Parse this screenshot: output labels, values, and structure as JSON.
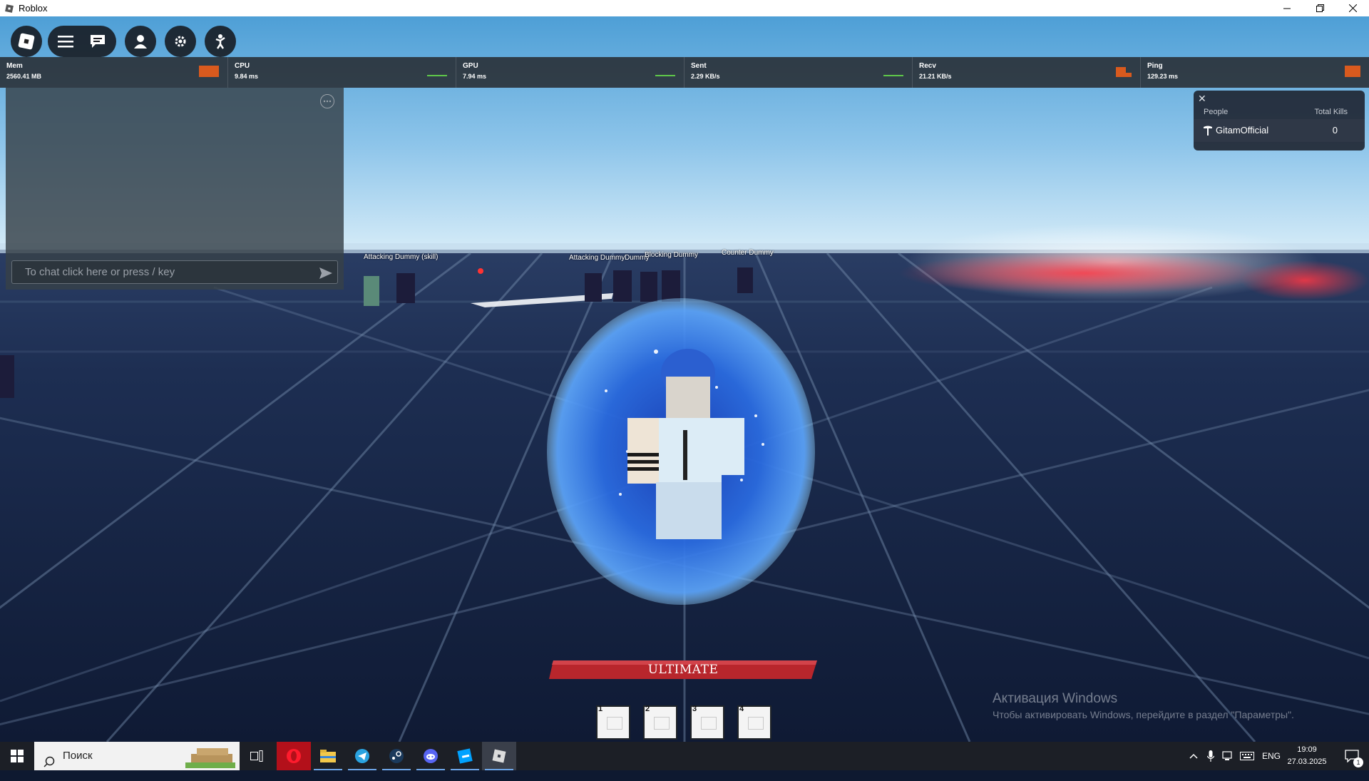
{
  "window": {
    "title": "Roblox"
  },
  "stats": [
    {
      "label": "Mem",
      "value": "2560.41 MB"
    },
    {
      "label": "CPU",
      "value": "9.84 ms"
    },
    {
      "label": "GPU",
      "value": "7.94 ms"
    },
    {
      "label": "Sent",
      "value": "2.29 KB/s"
    },
    {
      "label": "Recv",
      "value": "21.21 KB/s"
    },
    {
      "label": "Ping",
      "value": "129.23 ms"
    }
  ],
  "chat": {
    "placeholder": "To chat click here or press / key"
  },
  "leaderboard": {
    "col_people": "People",
    "col_kills": "Total Kills",
    "rows": [
      {
        "player": "GitamOfficial",
        "kills": "0"
      }
    ]
  },
  "dummies": [
    {
      "label": "Attacking Dummy (skill)"
    },
    {
      "label": "Attacking Dummy"
    },
    {
      "label": "Dummy"
    },
    {
      "label": "Blocking Dummy"
    },
    {
      "label": "Counter Dummy"
    }
  ],
  "hud": {
    "ultimate_label": "ULTIMATE",
    "slots": [
      {
        "number": "1"
      },
      {
        "number": "2"
      },
      {
        "number": "3"
      },
      {
        "number": "4"
      }
    ]
  },
  "activation": {
    "title": "Активация Windows",
    "subtitle": "Чтобы активировать Windows, перейдите в раздел \"Параметры\"."
  },
  "taskbar": {
    "search_label": "Поиск",
    "language": "ENG",
    "time": "19:09",
    "date": "27.03.2025",
    "notification_count": "1"
  },
  "colors": {
    "sky_top": "#4e9fd6",
    "floor": "#142240",
    "ultimate_bar": "#b8262c",
    "aura": "#2a6be0",
    "stat_bar": "#d95a1e",
    "stat_graph": "#5fc84a"
  }
}
